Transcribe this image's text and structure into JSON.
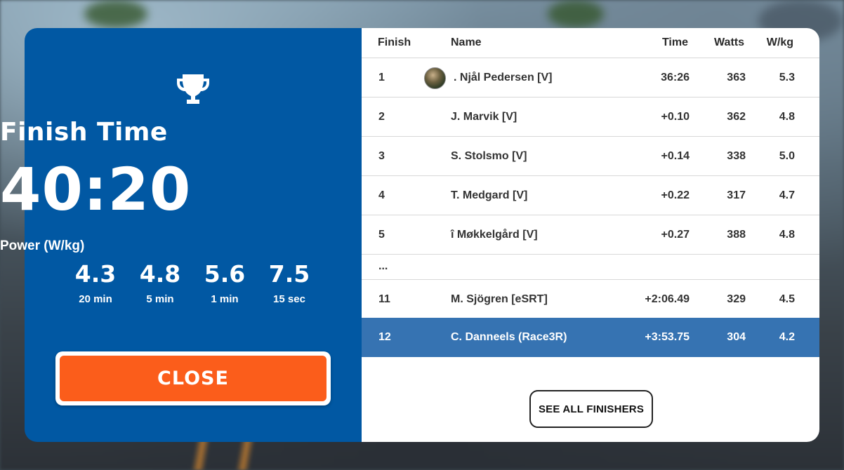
{
  "finish_panel": {
    "title": "Finish Time",
    "time": "40:20",
    "power_title": "Power (W/kg)",
    "power": [
      {
        "value": "4.3",
        "unit": "20 min"
      },
      {
        "value": "4.8",
        "unit": "5 min"
      },
      {
        "value": "5.6",
        "unit": "1 min"
      },
      {
        "value": "7.5",
        "unit": "15 sec"
      }
    ],
    "close_label": "CLOSE",
    "trophy_icon": "trophy-icon"
  },
  "results": {
    "headers": {
      "finish": "Finish",
      "name": "Name",
      "time": "Time",
      "watts": "Watts",
      "wkg": "W/kg"
    },
    "rows": [
      {
        "pos": "1",
        "name": ". Njål Pedersen [V]",
        "time": "36:26",
        "watts": "363",
        "wkg": "5.3"
      },
      {
        "pos": "2",
        "name": "J. Marvik [V]",
        "time": "+0.10",
        "watts": "362",
        "wkg": "4.8"
      },
      {
        "pos": "3",
        "name": "S. Stolsmo [V]",
        "time": "+0.14",
        "watts": "338",
        "wkg": "5.0"
      },
      {
        "pos": "4",
        "name": "T. Medgard [V]",
        "time": "+0.22",
        "watts": "317",
        "wkg": "4.7"
      },
      {
        "pos": "5",
        "name": "î Møkkelgård [V]",
        "time": "+0.27",
        "watts": "388",
        "wkg": "4.8"
      }
    ],
    "ellipsis": "...",
    "rows_after": [
      {
        "pos": "11",
        "name": "M. Sjögren [eSRT]",
        "time": "+2:06.49",
        "watts": "329",
        "wkg": "4.5"
      },
      {
        "pos": "12",
        "name": "C. Danneels (Race3R)",
        "time": "+3:53.75",
        "watts": "304",
        "wkg": "4.2"
      }
    ],
    "see_all_label": "SEE ALL FINISHERS"
  },
  "colors": {
    "panel_blue": "#0158a3",
    "close_orange": "#fb5d1b",
    "highlight_row": "#3673b2"
  }
}
